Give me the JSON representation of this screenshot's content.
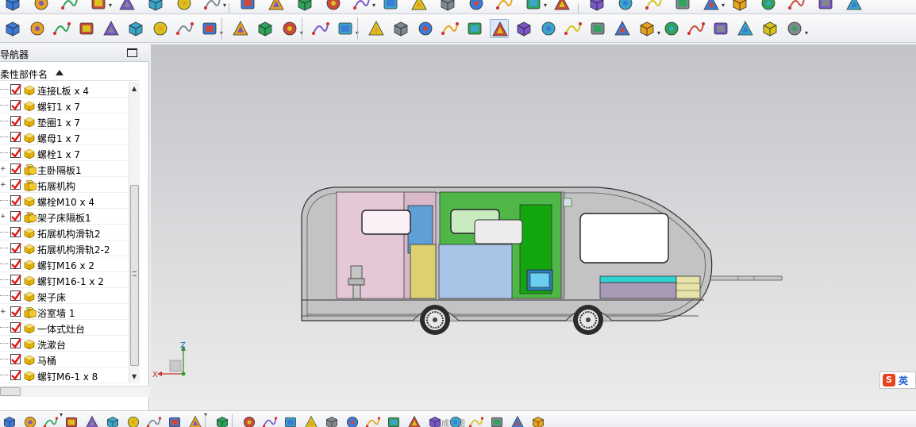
{
  "navigator": {
    "title": "导航器",
    "column_header": "柔性部件名",
    "parts": [
      {
        "label": "连接L板 x 4",
        "checked": true,
        "kind": "part",
        "expandable": false
      },
      {
        "label": "螺钉1 x 7",
        "checked": true,
        "kind": "part",
        "expandable": false
      },
      {
        "label": "垫圈1 x 7",
        "checked": true,
        "kind": "part",
        "expandable": false
      },
      {
        "label": "螺母1 x 7",
        "checked": true,
        "kind": "part",
        "expandable": false
      },
      {
        "label": "螺栓1 x 7",
        "checked": true,
        "kind": "part",
        "expandable": false
      },
      {
        "label": "主卧隔板1",
        "checked": true,
        "kind": "assembly",
        "expandable": true
      },
      {
        "label": "拓展机构",
        "checked": true,
        "kind": "assembly",
        "expandable": true
      },
      {
        "label": "螺栓M10 x 4",
        "checked": true,
        "kind": "part",
        "expandable": false
      },
      {
        "label": "架子床隔板1",
        "checked": true,
        "kind": "assembly",
        "expandable": true
      },
      {
        "label": "拓展机构滑轨2",
        "checked": true,
        "kind": "part",
        "expandable": false
      },
      {
        "label": "拓展机构滑轨2-2",
        "checked": true,
        "kind": "part",
        "expandable": false
      },
      {
        "label": "螺钉M16 x 2",
        "checked": true,
        "kind": "part",
        "expandable": false
      },
      {
        "label": "螺钉M16-1 x 2",
        "checked": true,
        "kind": "part",
        "expandable": false
      },
      {
        "label": "架子床",
        "checked": true,
        "kind": "part",
        "expandable": false
      },
      {
        "label": "浴室墙 1",
        "checked": true,
        "kind": "assembly",
        "expandable": true
      },
      {
        "label": "一体式灶台",
        "checked": true,
        "kind": "part",
        "expandable": false
      },
      {
        "label": "洗漱台",
        "checked": true,
        "kind": "part",
        "expandable": false
      },
      {
        "label": "马桶",
        "checked": true,
        "kind": "part",
        "expandable": false
      },
      {
        "label": "螺钉M6-1 x 8",
        "checked": true,
        "kind": "part",
        "expandable": false
      }
    ]
  },
  "toolbar_bottom": {
    "finish_sketch_label": "完成草图"
  },
  "triad": {
    "z_label": "Z",
    "x_label": "X"
  },
  "ime": {
    "logo": "S",
    "mode": "英"
  },
  "colors": {
    "checkbox_check": "#e01818",
    "part_icon": "#e8b400",
    "viewport_top": "#c3c4c8",
    "viewport_bottom": "#ececec",
    "bathroom_wall": "#e5c8d8",
    "kitchen_green": "#14a60e",
    "table_blue": "#a8c4e6",
    "cabinet_yellow": "#dcd070",
    "tall_blue_panel": "#5e9fd6",
    "bed_cyan": "#30d2d2",
    "bed_purple": "#a89bb6"
  },
  "icons": {
    "top_row": [
      "sketch-icon",
      "extrude-icon",
      "revolve-icon",
      "box-icon",
      "cylinder-icon",
      "hole-icon",
      "pattern-icon",
      "boolean-icon",
      "blend-icon",
      "chamfer-icon",
      "shell-icon",
      "draft-icon"
    ],
    "second_row": [
      "spline-icon",
      "face-icon",
      "curve-icon",
      "project-icon",
      "point-icon",
      "point-set-icon",
      "offset-curve-icon",
      "section-curve-icon",
      "intersect-curve-icon",
      "coil-icon",
      "spring-icon",
      "tire-icon",
      "thread-icon",
      "camera-icon",
      "layer-icon",
      "paint-icon",
      "color-icon",
      "material-icon",
      "light-icon",
      "selection-icon",
      "user-icon",
      "image-icon",
      "texture-icon",
      "view-icon",
      "sphere-icon",
      "cube-icon",
      "render-icon",
      "wireframe-icon",
      "zoom-icon",
      "section-view-icon",
      "measure-icon",
      "analysis-icon"
    ],
    "bottom_row": [
      "assembly-icon",
      "add-component-icon",
      "new-parent-icon",
      "move-component-icon",
      "constraint-icon",
      "array-icon",
      "mirror-icon",
      "explode-icon",
      "wave-icon",
      "reference-set-icon",
      "finish-sketch-icon",
      "profile-icon",
      "line-icon",
      "arc-icon",
      "circle-icon",
      "fillet-icon",
      "chamfer-sketch-icon",
      "rectangle-icon",
      "polygon-icon",
      "plus-icon",
      "offset-icon",
      "trim-icon",
      "extend-icon",
      "corner-icon",
      "dimension-icon",
      "constraint-sketch-icon"
    ]
  }
}
